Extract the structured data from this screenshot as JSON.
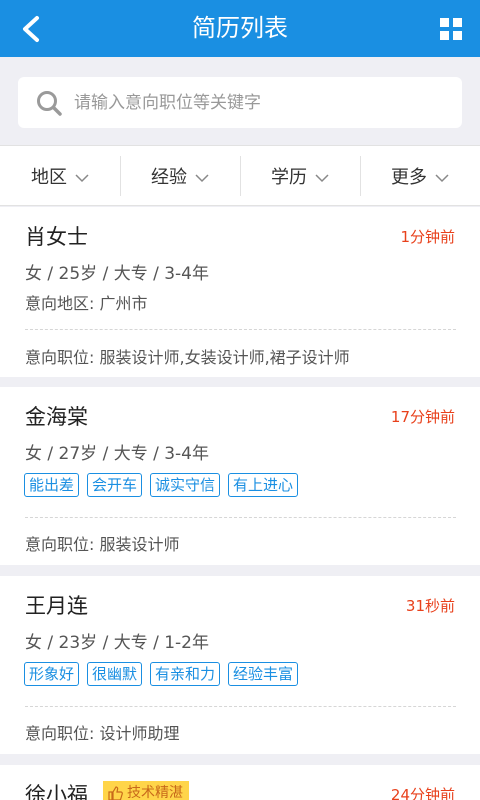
{
  "header": {
    "title": "简历列表"
  },
  "search": {
    "placeholder": "请输入意向职位等关键字"
  },
  "filters": [
    {
      "label": "地区"
    },
    {
      "label": "经验"
    },
    {
      "label": "学历"
    },
    {
      "label": "更多"
    }
  ],
  "resumes": [
    {
      "name": "肖女士",
      "time": "1分钟前",
      "info": "女 / 25岁 / 大专 / 3-4年",
      "region": "意向地区: 广州市",
      "position": "意向职位: 服装设计师,女装设计师,裙子设计师"
    },
    {
      "name": "金海棠",
      "time": "17分钟前",
      "info": "女 / 27岁 / 大专 / 3-4年",
      "tags": [
        "能出差",
        "会开车",
        "诚实守信",
        "有上进心"
      ],
      "position": "意向职位: 服装设计师"
    },
    {
      "name": "王月连",
      "time": "31秒前",
      "info": "女 / 23岁 / 大专 / 1-2年",
      "tags": [
        "形象好",
        "很幽默",
        "有亲和力",
        "经验丰富"
      ],
      "position": "意向职位: 设计师助理"
    },
    {
      "name": "徐小福",
      "badge": "技术精湛",
      "time": "24分钟前"
    }
  ],
  "colors": {
    "primary": "#1a8fe2",
    "time": "#e8411c",
    "badge_bg": "#ffd54a"
  }
}
